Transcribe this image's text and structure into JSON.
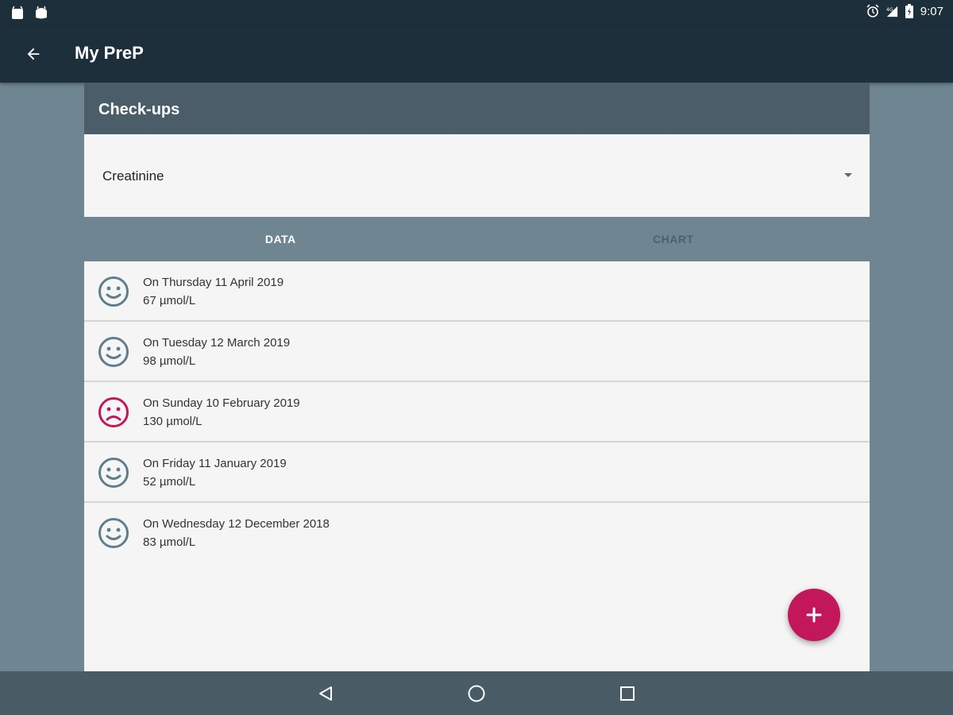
{
  "status_bar": {
    "time": "9:07",
    "left_icons": [
      "android-icon",
      "android-icon"
    ],
    "right_icons": [
      "alarm-icon",
      "signal-icon",
      "battery-icon"
    ]
  },
  "app_bar": {
    "title": "My PreP"
  },
  "section": {
    "title": "Check-ups"
  },
  "dropdown": {
    "selected": "Creatinine"
  },
  "tabs": [
    {
      "label": "DATA",
      "active": true
    },
    {
      "label": "CHART",
      "active": false
    }
  ],
  "entries": [
    {
      "date": "On Thursday 11 April 2019",
      "value": "67 µmol/L",
      "status": "normal"
    },
    {
      "date": "On Tuesday 12 March 2019",
      "value": "98 µmol/L",
      "status": "normal"
    },
    {
      "date": "On Sunday 10 February 2019",
      "value": "130 µmol/L",
      "status": "abnormal"
    },
    {
      "date": "On Friday 11 January 2019",
      "value": "52 µmol/L",
      "status": "normal"
    },
    {
      "date": "On Wednesday 12 December 2018",
      "value": "83 µmol/L",
      "status": "normal"
    }
  ],
  "colors": {
    "normal_face": "#607d8b",
    "abnormal_face": "#c2175b",
    "accent": "#c2175b",
    "app_bar": "#1d2f3a"
  },
  "fab": {
    "icon": "plus-icon"
  },
  "nav_bar": {
    "buttons": [
      "back-triangle-icon",
      "home-circle-icon",
      "recents-square-icon"
    ]
  }
}
